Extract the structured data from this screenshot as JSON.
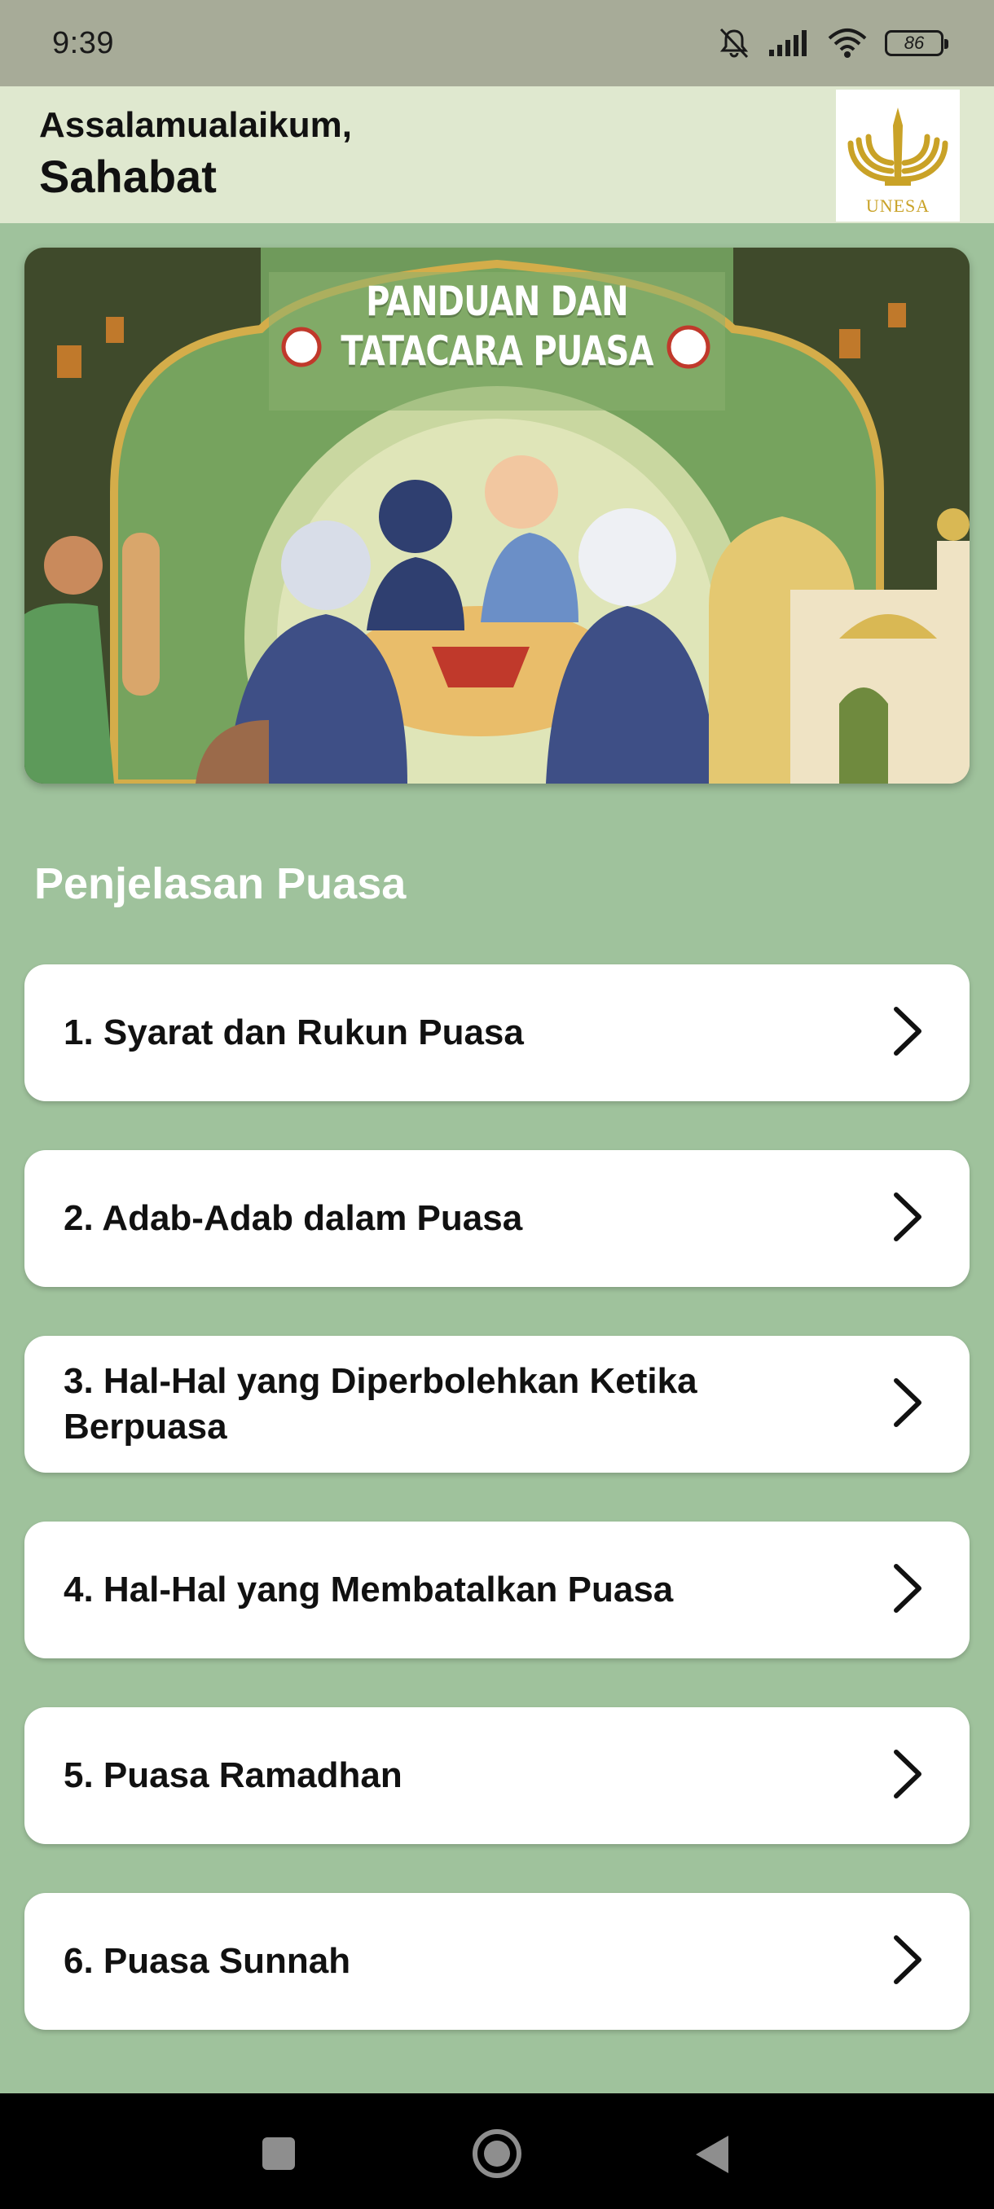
{
  "status_bar": {
    "time": "9:39",
    "battery": "86",
    "icons": [
      "mute-icon",
      "signal-icon",
      "wifi-icon",
      "battery-icon"
    ]
  },
  "header": {
    "greeting": "Assalamualaikum,",
    "name": "Sahabat",
    "logo_text": "UNESA"
  },
  "banner": {
    "title_line1": "PANDUAN DAN",
    "title_line2": "TATACARA PUASA"
  },
  "section": {
    "title": "Penjelasan Puasa"
  },
  "menu": {
    "items": [
      {
        "label": "1. Syarat dan Rukun Puasa"
      },
      {
        "label": "2. Adab-Adab dalam Puasa"
      },
      {
        "label": "3. Hal-Hal yang Diperbolehkan Ketika Berpuasa"
      },
      {
        "label": "4. Hal-Hal yang Membatalkan Puasa"
      },
      {
        "label": "5. Puasa Ramadhan"
      },
      {
        "label": "6. Puasa Sunnah"
      }
    ]
  },
  "colors": {
    "background": "#9fc29c",
    "header": "#dfe8cf",
    "status_bar": "#a7ab98",
    "logo_gold": "#c9a227"
  }
}
